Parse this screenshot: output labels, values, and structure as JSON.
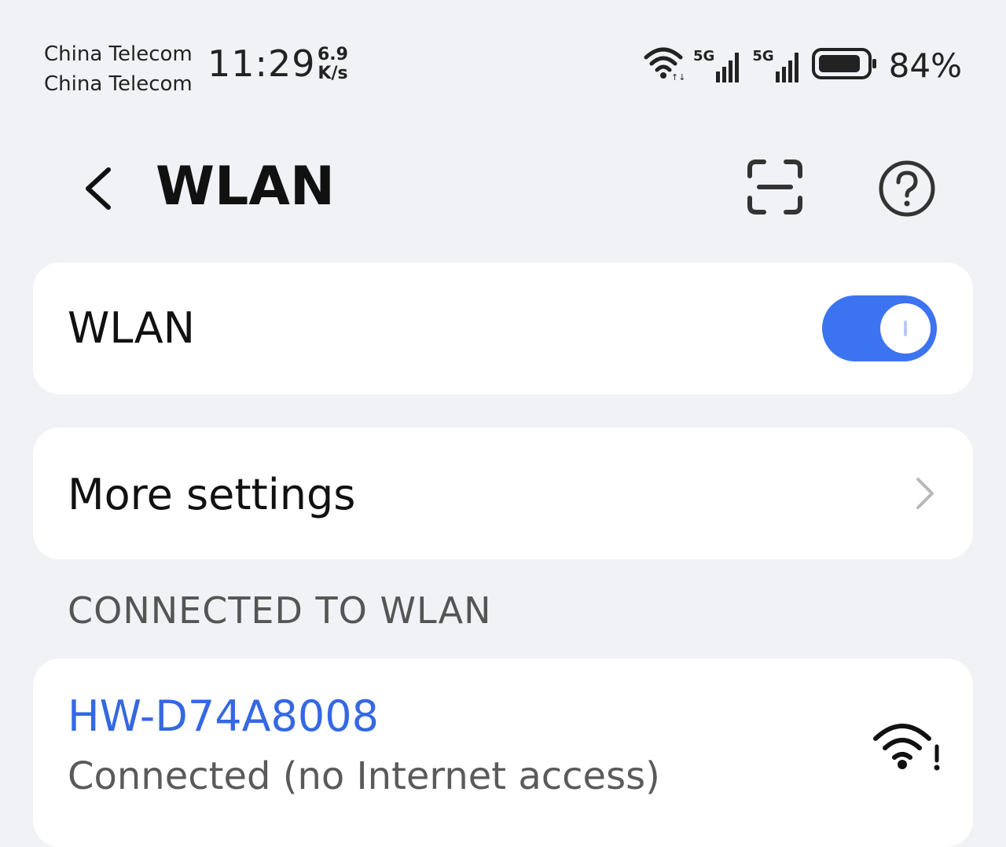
{
  "status_bar": {
    "carrier_1": "China Telecom",
    "carrier_2": "China Telecom",
    "time": "11:29",
    "speed_value": "6.9",
    "speed_unit": "K/s",
    "signal_1_label": "5G",
    "signal_2_label": "5G",
    "battery_percent": "84%",
    "icons": [
      "wifi-icon",
      "signal-5g-icon",
      "signal-5g-icon",
      "battery-icon"
    ]
  },
  "header": {
    "title": "WLAN",
    "back_icon": "chevron-left-icon",
    "scan_icon": "scan-icon",
    "help_icon": "help-circle-icon"
  },
  "wlan_toggle": {
    "label": "WLAN",
    "enabled": true
  },
  "more_settings": {
    "label": "More settings",
    "icon": "chevron-right-icon"
  },
  "connected_section": {
    "header": "CONNECTED TO WLAN",
    "network": {
      "name": "HW-D74A8008",
      "status": "Connected (no Internet access)",
      "icon": "wifi-warning-icon"
    }
  },
  "colors": {
    "background": "#f1f2f6",
    "card": "#ffffff",
    "accent": "#3c73f0",
    "network_name": "#3568e3",
    "secondary_text": "#5a5a5a"
  }
}
